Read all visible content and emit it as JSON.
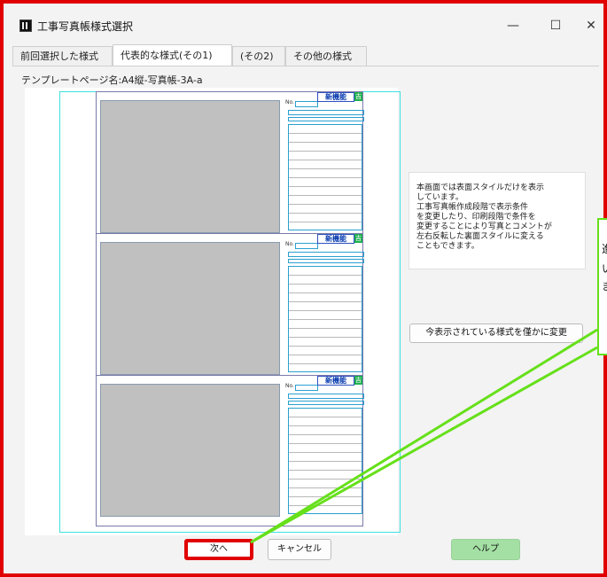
{
  "window": {
    "title": "工事写真帳様式選択",
    "minimize_glyph": "—",
    "maximize_glyph": "☐",
    "close_glyph": "✕"
  },
  "tabs": [
    {
      "label": "前回選択した様式",
      "active": false
    },
    {
      "label": "代表的な様式(その1)",
      "active": true
    },
    {
      "label": "(その2)",
      "active": false
    },
    {
      "label": "その他の様式",
      "active": false
    }
  ],
  "template": {
    "name_label": "テンプレートページ名:A4縦-写真帳-3A-a"
  },
  "preview": {
    "stamp_text": "新機能",
    "stamp_green": "吉",
    "sig_label": "No."
  },
  "info": {
    "text": "本画面では表面スタイルだけを表示\nしています。\n工事写真帳作成段階で表示条件\nを変更したり、印刷段階で条件を\n変更することにより写真とコメントが\n左右反転した裏面スタイルに変える\nこともできます。"
  },
  "buttons": {
    "change_style": "今表示されている様式を僅かに変更",
    "next": "次へ",
    "cancel": "キャンセル",
    "help": "ヘルプ"
  },
  "callout": {
    "line1": "進",
    "line2": "い",
    "line3": "ま"
  },
  "colors": {
    "highlight_red": "#e00000",
    "callout_green": "#66e01a",
    "help_green": "#a4e0a4",
    "stamp_blue": "#0a3cb0"
  }
}
